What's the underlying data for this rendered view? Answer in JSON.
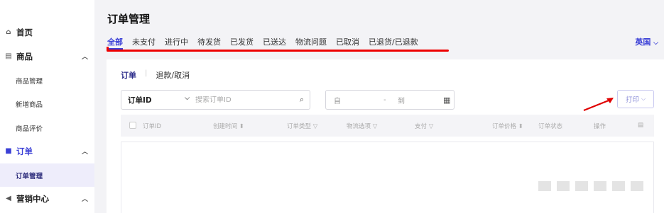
{
  "sidebar": {
    "items": [
      {
        "icon": "home-icon",
        "label": "首页"
      },
      {
        "icon": "product-icon",
        "label": "商品",
        "expanded": true,
        "children": [
          "商品管理",
          "新增商品",
          "商品评价"
        ]
      },
      {
        "icon": "order-icon",
        "label": "订单",
        "expanded": true,
        "active": true,
        "children": [
          "订单管理"
        ]
      },
      {
        "icon": "marketing-icon",
        "label": "营销中心",
        "expanded": true
      }
    ]
  },
  "header": {
    "title": "订单管理",
    "language": "英国",
    "tabs": [
      "全部",
      "未支付",
      "进行中",
      "待发货",
      "已发货",
      "已送达",
      "物流问题",
      "已取消",
      "已退货/已退款"
    ],
    "active_tab": "全部"
  },
  "main": {
    "subtabs": [
      "订单",
      "退款/取消"
    ],
    "active_subtab": "订单",
    "filter": {
      "select_value": "订单ID",
      "search_placeholder": "搜索订单ID",
      "date_from": "自",
      "date_sep": "-",
      "date_to": "到"
    },
    "print_label": "打印",
    "table_headers": [
      "订单ID",
      "创建时间",
      "订单类型",
      "物流选项",
      "支付",
      "订单价格",
      "订单状态",
      "操作"
    ]
  },
  "annotation_color": "#e00000",
  "accent_color": "#3a3fd6"
}
